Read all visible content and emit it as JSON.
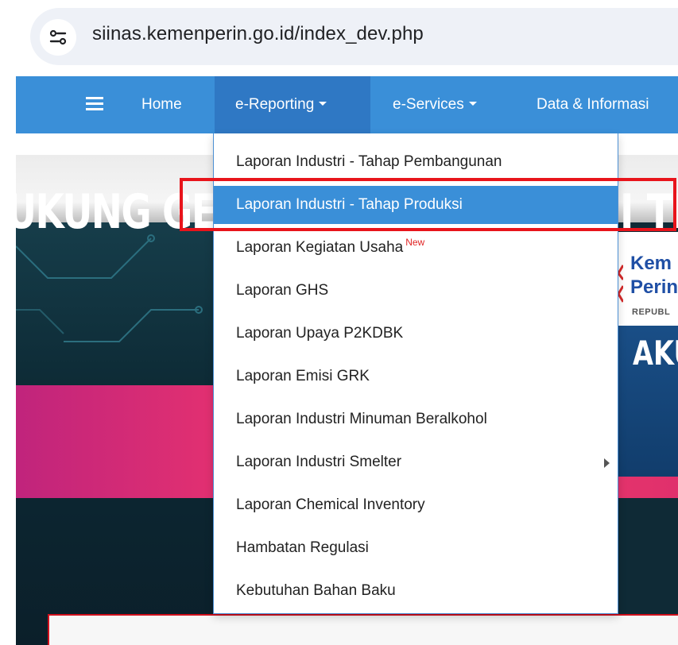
{
  "browser": {
    "url": "siinas.kemenperin.go.id/index_dev.php",
    "site_info_icon": "tune-icon"
  },
  "navbar": {
    "menu_icon": "hamburger-icon",
    "items": [
      {
        "label": "Home",
        "has_caret": false
      },
      {
        "label": "e-Reporting",
        "has_caret": true,
        "active": true
      },
      {
        "label": "e-Services",
        "has_caret": true
      },
      {
        "label": "Data & Informasi",
        "has_caret": false
      }
    ]
  },
  "dropdown": {
    "items": [
      {
        "label": "Laporan Industri - Tahap Pembangunan"
      },
      {
        "label": "Laporan Industri - Tahap Produksi",
        "highlighted": true
      },
      {
        "label": "Laporan Kegiatan Usaha",
        "badge": "New"
      },
      {
        "label": "Laporan GHS"
      },
      {
        "label": "Laporan Upaya P2KDBK"
      },
      {
        "label": "Laporan Emisi GRK"
      },
      {
        "label": "Laporan Industri Minuman Beralkohol"
      },
      {
        "label": "Laporan Industri Smelter",
        "has_submenu": true
      },
      {
        "label": "Laporan Chemical Inventory"
      },
      {
        "label": "Hambatan Regulasi"
      },
      {
        "label": "Kebutuhan Bahan Baku"
      }
    ]
  },
  "banner": {
    "text_left": "UKUNG GE",
    "text_right": "I TK",
    "text_bottom_right": "AKU",
    "logo_line1": "Kem",
    "logo_line2": "Perin",
    "logo_line3": "REPUBL"
  },
  "colors": {
    "navbar": "#3a8fd8",
    "nav_active": "#2f78c4",
    "highlight": "#3a8fd8",
    "annotation_red": "#e8141b",
    "badge_red": "#e02424"
  }
}
